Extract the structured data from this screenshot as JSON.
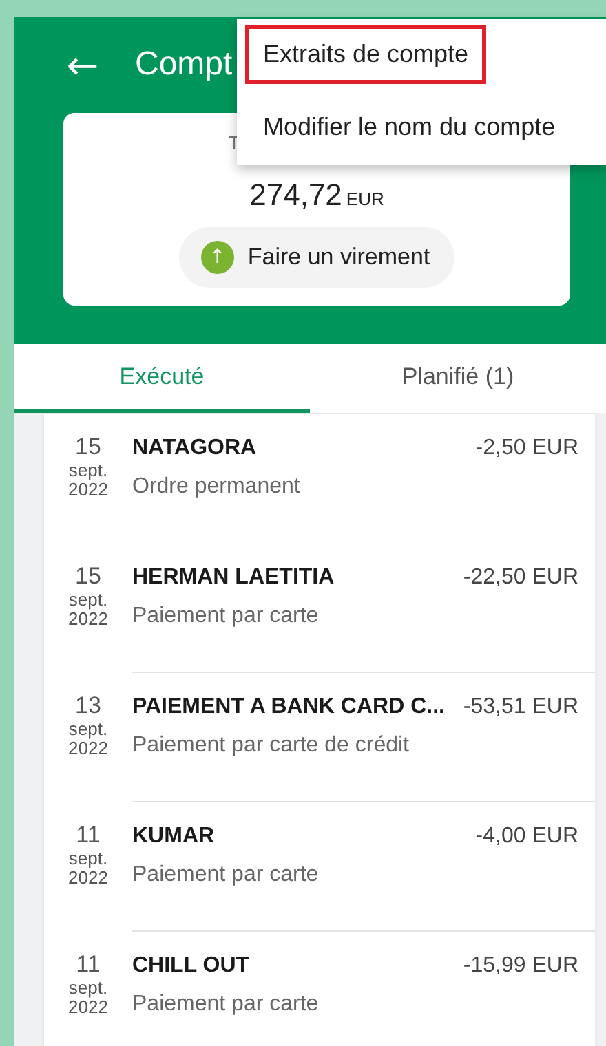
{
  "header": {
    "back": "←",
    "title": "Compt"
  },
  "balance": {
    "label": "T",
    "amount": "274,72",
    "currency": "EUR"
  },
  "transfer_button": {
    "icon": "↑",
    "label": "Faire un virement"
  },
  "menu": {
    "items": [
      {
        "label": "Extraits de compte",
        "highlighted": true
      },
      {
        "label": "Modifier le nom du compte",
        "highlighted": false
      }
    ]
  },
  "tabs": [
    {
      "label": "Exécuté",
      "selected": true
    },
    {
      "label": "Planifié (1)",
      "selected": false
    }
  ],
  "transactions": [
    {
      "day": "15",
      "month": "sept.",
      "year": "2022",
      "name": "NATAGORA",
      "type": "Ordre permanent",
      "amount": "-2,50 EUR"
    },
    {
      "day": "15",
      "month": "sept.",
      "year": "2022",
      "name": "HERMAN LAETITIA",
      "type": "Paiement par carte",
      "amount": "-22,50 EUR"
    },
    {
      "day": "13",
      "month": "sept.",
      "year": "2022",
      "name": "PAIEMENT A BANK CARD C...",
      "type": "Paiement par carte de crédit",
      "amount": "-53,51 EUR"
    },
    {
      "day": "11",
      "month": "sept.",
      "year": "2022",
      "name": "KUMAR",
      "type": "Paiement par carte",
      "amount": "-4,00 EUR"
    },
    {
      "day": "11",
      "month": "sept.",
      "year": "2022",
      "name": "CHILL OUT",
      "type": "Paiement par carte",
      "amount": "-15,99 EUR"
    }
  ]
}
